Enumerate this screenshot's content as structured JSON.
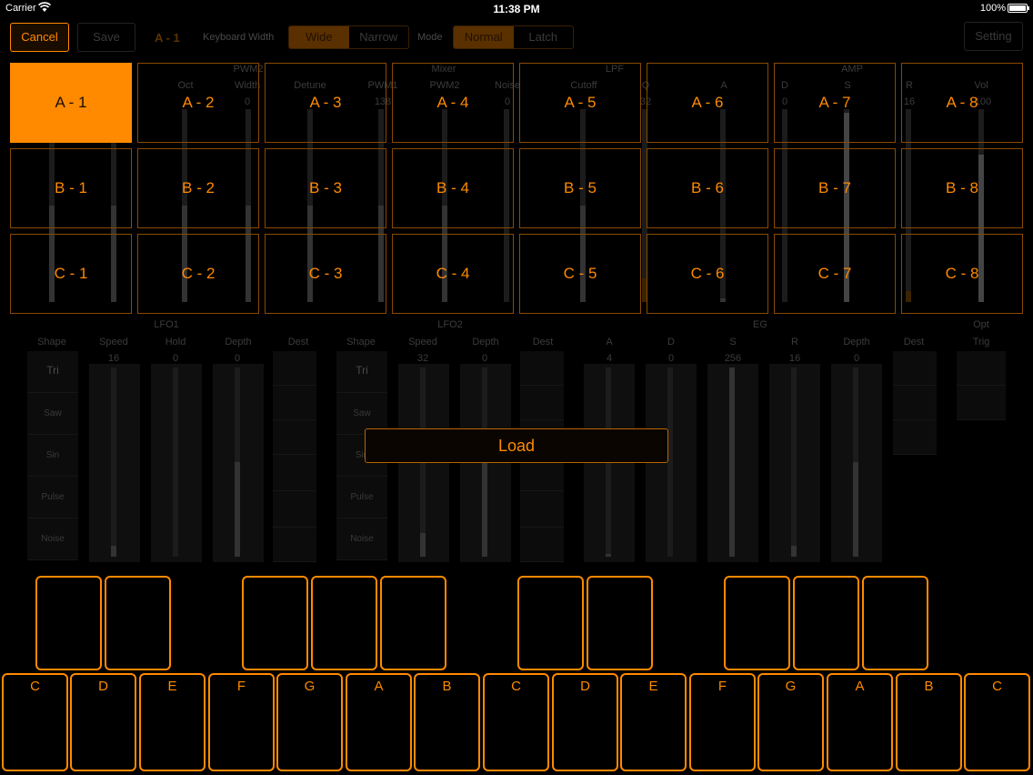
{
  "status": {
    "carrier": "Carrier",
    "time": "11:38 PM",
    "battery": "100%"
  },
  "toolbar": {
    "cancel": "Cancel",
    "save": "Save",
    "patch": "A - 1",
    "keyboard_width_label": "Keyboard Width",
    "width_options": [
      "Wide",
      "Narrow"
    ],
    "width_selected": "Wide",
    "mode_label": "Mode",
    "mode_options": [
      "Normal",
      "Latch"
    ],
    "mode_selected": "Normal",
    "setting": "Setting"
  },
  "bg_top": {
    "groups": [
      "PWM2",
      "Mixer",
      "LPF",
      "AMP"
    ],
    "params": [
      "Oct",
      "Width",
      "Detune",
      "PWM1",
      "PWM2",
      "Noise",
      "Cutoff",
      "Q",
      "A",
      "D",
      "S",
      "R",
      "Vol"
    ],
    "values": [
      "0",
      "138",
      "0",
      "32",
      "0",
      "16",
      "100"
    ]
  },
  "presets": {
    "rows": [
      [
        "A - 1",
        "A - 2",
        "A - 3",
        "A - 4",
        "A - 5",
        "A - 6",
        "A - 7",
        "A - 8"
      ],
      [
        "B - 1",
        "B - 2",
        "B - 3",
        "B - 4",
        "B - 5",
        "B - 6",
        "B - 7",
        "B - 8"
      ],
      [
        "C - 1",
        "C - 2",
        "C - 3",
        "C - 4",
        "C - 5",
        "C - 6",
        "C - 7",
        "C - 8"
      ]
    ],
    "selected": "A - 1"
  },
  "bg_bottom": {
    "groups": [
      "LFO1",
      "LFO2",
      "EG",
      "Opt"
    ],
    "labels": [
      "Shape",
      "Speed",
      "Hold",
      "Depth",
      "Dest",
      "Shape",
      "Speed",
      "Depth",
      "Dest",
      "A",
      "D",
      "S",
      "R",
      "Depth",
      "Dest",
      "Trig"
    ],
    "values": [
      "16",
      "0",
      "0",
      "32",
      "0",
      "4",
      "0",
      "256",
      "16",
      "0"
    ],
    "shapes1": [
      "Tri",
      "Saw",
      "Sin",
      "Pulse",
      "Noise"
    ],
    "shapes2": [
      "Tri",
      "Saw",
      "Sin",
      "Pulse",
      "Noise"
    ]
  },
  "load": "Load",
  "keyboard": {
    "white_keys": [
      "C",
      "D",
      "E",
      "F",
      "G",
      "A",
      "B",
      "C",
      "D",
      "E",
      "F",
      "G",
      "A",
      "B",
      "C"
    ]
  },
  "colors": {
    "accent": "#ff8a00",
    "background": "#000000"
  }
}
